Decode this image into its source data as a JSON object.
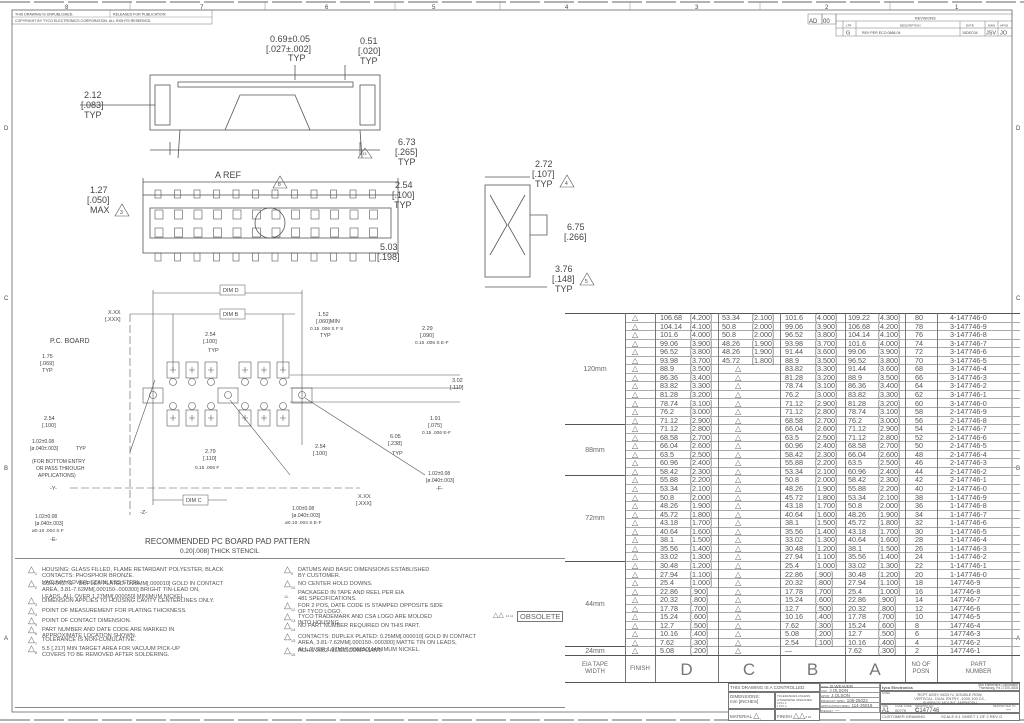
{
  "sheet": {
    "zones_top": [
      "8",
      "7",
      "6",
      "5",
      "4",
      "3",
      "2",
      "1"
    ],
    "zones_side": [
      "D",
      "C",
      "B",
      "A"
    ],
    "unpublished": "THIS DRAWING IS UNPUBLISHED.",
    "released": "RELEASED FOR PUBLICATION",
    "copyright": "COPYRIGHT   BY TYCO ELECTRONICS CORPORATION. ALL RIGHTS RESERVED."
  },
  "revisions": {
    "title": "REVISIONS",
    "dist": "AD",
    "sheet_code": "00",
    "col_ltr": "LTR",
    "col_description": "DESCRIPTION",
    "col_date": "DATE",
    "col_dwn": "DWN",
    "col_apvd": "APVD",
    "ltr": "G",
    "description": "REV PER ECO 0686 04",
    "date": "15DEC04",
    "dwn": "JSV",
    "apvd": "JO"
  },
  "views": {
    "front": {
      "d1": "0.69±0.05",
      "d1b": "[.027±.002]",
      "d1c": "TYP",
      "d2": "0.51",
      "d2b": "[.020]",
      "d2c": "TYP",
      "d3": "2.12",
      "d3b": "[.083]",
      "d3c": "TYP",
      "d4": "6.73",
      "d4b": "[.265]",
      "d4c": "TYP",
      "flag": "13"
    },
    "top": {
      "aref": "A REF",
      "flag8": "8",
      "d1": "1.27",
      "d1b": "[.050]",
      "d1c": "MAX",
      "flag3": "3",
      "d2": "2.54",
      "d2b": "[.100]",
      "d2c": "TYP",
      "flag7": "7",
      "d3": "5.03",
      "d3b": "[.198]"
    },
    "side": {
      "d1": "2.72",
      "d1b": "[.107]",
      "d1c": "TYP",
      "flag4": "4",
      "d2": "6.75",
      "d2b": "[.266]",
      "d3": "3.76",
      "d3b": "[.148]",
      "d3c": "TYP",
      "flag5": "5"
    },
    "pad": {
      "dim_d": "DIM D",
      "dim_b": "DIM B",
      "dim_c": "DIM C",
      "xx": "X.XX",
      "xxx": "[.XXX]",
      "flag9": "9",
      "pcb": "P.C. BOARD",
      "a1": "1.75",
      "a1b": "[.069]",
      "a1c": "TYP",
      "a2": "2.54",
      "a2b": "[.100]",
      "a2c": "TYP",
      "a3": "1.52",
      "a3b": "[.060]MIN",
      "a3c": "0.15  .006 S F S",
      "a3d": "TYP",
      "a4": "2.29",
      "a4b": "[.090]",
      "a4c": "0.15  .006 S E-F",
      "a5": "3.02",
      "a5b": "[.119]",
      "a6": "2.54",
      "a6b": "[.100]",
      "a7": "1.91",
      "a7b": "[.075]",
      "a7c": "0.15  .006 E-F",
      "a8": "6.05",
      "a8b": "[.238]",
      "a8c": "TYP",
      "a9": "2.54",
      "a9b": "[.100]",
      "a10": "2.79",
      "a10b": "[.110]",
      "a10c": "0.15  .006 F",
      "h1": "1.02±0.08",
      "h1b": "[ø.040±.003]",
      "h1c": "TYP",
      "bottom_entry": "(FOR BOTTOM ENTRY",
      "bottom_entry2": "OR PASS THROUGH",
      "bottom_entry3": "APPLICATIONS)",
      "h2": "1.02±0.08",
      "h2b": "[ø.040±.003]",
      "h2c": "ø0.10  .004 S F",
      "h3": "1.00±0.08",
      "h3b": "[ø.040±.003]",
      "h3c": "ø0.10  .004 S E-F",
      "h4": "1.02±0.08",
      "h4b": "[ø.040±.003]",
      "datum_y": "-Y-",
      "datum_z": "-Z-",
      "datum_e": "-E-",
      "datum_f": "-F-",
      "caption": "RECOMMENDED PC BOARD PAD PATTERN",
      "caption2": "0.20[.008] THICK STENCIL"
    }
  },
  "notes": [
    {
      "num": "1",
      "text": "HOUSING: GLASS FILLED, FLAME RETARDANT POLYESTER, BLACK\nCONTACTS: PHOSPHOR BRONZE.\nVACUUM COVER: STAINLESS STEEL"
    },
    {
      "num": "2",
      "text": "CONTACTS:   DUPLEX PLATED: 0.25µm[.000010] GOLD IN CONTACT\nAREA, 3.81-7.62µm[.000150-.000300] BRIGHT TIN-LEAD ON,\nLEADS, ALL OVER 1.27µm[.000050] MINIMUM NICKEL."
    },
    {
      "num": "3",
      "text": "DIMENSION APPLIES TO HOUSING CAVITY CENTERLINES ONLY."
    },
    {
      "num": "4",
      "text": "POINT OF MEASUREMENT FOR PLATING THICKNESS."
    },
    {
      "num": "5",
      "text": "POINT OF CONTACT DIMENSION."
    },
    {
      "num": "6",
      "text": "PART NUMBER AND DATE CODE ARE MARKED IN\nAPPROXIMATE LOCATION SHOWN."
    },
    {
      "num": "7",
      "text": "TOLERANCE IS NON-CUMULATIVE."
    },
    {
      "num": "8",
      "text": "5.5 [.217] MIN TARGET AREA FOR VACUUM PICK-UP\nCOVERS TO BE REMOVED AFTER SOLDERING."
    },
    {
      "num": "9",
      "text": "DATUMS AND BASIC DIMENSIONS ESTABLISHED\nBY CUSTOMER."
    },
    {
      "num": "10",
      "text": "NO CENTER HOLD DOWNS."
    },
    {
      "num": "11.",
      "text": "PACKAGED IN TAPE AND REEL PER EIA\n481 SPECIFICATIONS."
    },
    {
      "num": "12",
      "text": "FOR 2 POS, DATE CODE IS STAMPED OPPOSITE SIDE\nOF TYCO LOGO."
    },
    {
      "num": "13",
      "text": "TYCO TRADEMARK AND CSA LOGO ARE MOLDED\nINTO HOUSING."
    },
    {
      "num": "14",
      "text": "NO PART NUMBER REQUIRED ON THIS PART."
    },
    {
      "num": "15",
      "text": "CONTACTS: DUPLEX PLATED: 0.25µm[.000010] GOLD IN CONTACT\nAREA, 3.81-7.62µm[.000150-.000300] MATTE TIN ON LEADS,\nALL OVER 1.27µm[.000050] MINIMUM NICKEL."
    },
    {
      "num": "16",
      "text": "ROHS 2002 /95/EC COMPLIANT."
    }
  ],
  "table": {
    "obsolete_flags": "12 14",
    "obsolete": "OBSOLETE",
    "finish_flag": "13",
    "headers": {
      "tape": "EIA TAPE\nWIDTH",
      "finish": "FINISH",
      "d": "D",
      "c": "C",
      "b": "B",
      "a": "A",
      "posn": "NO OF\nPOSN",
      "part": "PART\nNUMBER"
    },
    "groups": [
      {
        "label": "120mm",
        "rows": 13
      },
      {
        "label": "88mm",
        "rows": 6
      },
      {
        "label": "72mm",
        "rows": 10
      },
      {
        "label": "44mm",
        "rows": 10
      },
      {
        "label": "24mm",
        "rows": 1
      }
    ],
    "rows": [
      [
        "106.68",
        "[4.200]",
        "53.34",
        "[2.100]",
        "101.6",
        "[4.000]",
        "109.22",
        "[4.300]",
        "80",
        "4-147746-0"
      ],
      [
        "104.14",
        "[4.100]",
        "50.8",
        "[2.000]",
        "99.06",
        "[3.900]",
        "106.68",
        "[4.200]",
        "78",
        "3-147746-9"
      ],
      [
        "101.6",
        "[4.000]",
        "50.8",
        "[2.000]",
        "96.52",
        "[3.800]",
        "104.14",
        "[4.100]",
        "76",
        "3-147746-8"
      ],
      [
        "99.06",
        "[3.900]",
        "48.26",
        "[1.900]",
        "93.98",
        "[3.700]",
        "101.6",
        "[4.000]",
        "74",
        "3-147746-7"
      ],
      [
        "96.52",
        "[3.800]",
        "48.26",
        "[1.900]",
        "91.44",
        "[3.600]",
        "99.06",
        "[3.900]",
        "72",
        "3-147746-6"
      ],
      [
        "93.98",
        "[3.700]",
        "45.72",
        "[1.800]",
        "88.9",
        "[3.500]",
        "96.52",
        "[3.800]",
        "70",
        "3-147746-5"
      ],
      [
        "88.9",
        "[3.500]",
        "",
        "",
        "83.82",
        "[3.300]",
        "91.44",
        "[3.600]",
        "68",
        "3-147746-4"
      ],
      [
        "86.36",
        "[3.400]",
        "",
        "",
        "81.28",
        "[3.200]",
        "88.9",
        "[3.500]",
        "66",
        "3-147746-3"
      ],
      [
        "83.82",
        "[3.300]",
        "",
        "",
        "78.74",
        "[3.100]",
        "86.36",
        "[3.400]",
        "64",
        "3-147746-2"
      ],
      [
        "81.28",
        "[3.200]",
        "",
        "",
        "76.2",
        "[3.000]",
        "83.82",
        "[3.300]",
        "62",
        "3-147746-1"
      ],
      [
        "78.74",
        "[3.100]",
        "",
        "",
        "71.12",
        "[2.900]",
        "81.28",
        "[3.200]",
        "60",
        "3-147746-0"
      ],
      [
        "76.2",
        "[3.000]",
        "",
        "",
        "71.12",
        "[2.800]",
        "78.74",
        "[3.100]",
        "58",
        "2-147746-9"
      ],
      [
        "71.12",
        "[2.900]",
        "",
        "",
        "68.58",
        "[2.700]",
        "76.2",
        "[3.000]",
        "56",
        "2-147746-8"
      ],
      [
        "71.12",
        "[2.800]",
        "",
        "",
        "66.04",
        "[2.600]",
        "71.12",
        "[2.900]",
        "54",
        "2-147746-7"
      ],
      [
        "68.58",
        "[2.700]",
        "",
        "",
        "63.5",
        "[2.500]",
        "71.12",
        "[2.800]",
        "52",
        "2-147746-6"
      ],
      [
        "66.04",
        "[2.600]",
        "",
        "",
        "60.96",
        "[2.400]",
        "68.58",
        "[2.700]",
        "50",
        "2-147746-5"
      ],
      [
        "63.5",
        "[2.500]",
        "",
        "",
        "58.42",
        "[2.300]",
        "66.04",
        "[2.600]",
        "48",
        "2-147746-4"
      ],
      [
        "60.96",
        "[2.400]",
        "",
        "",
        "55.88",
        "[2.200]",
        "63.5",
        "[2.500]",
        "46",
        "2-147746-3"
      ],
      [
        "58.42",
        "[2.300]",
        "",
        "",
        "53.34",
        "[2.100]",
        "60.96",
        "[2.400]",
        "44",
        "2-147746-2"
      ],
      [
        "55.88",
        "[2.200]",
        "",
        "",
        "50.8",
        "[2.000]",
        "58.42",
        "[2.300]",
        "42",
        "2-147746-1"
      ],
      [
        "53.34",
        "[2.100]",
        "",
        "",
        "48.26",
        "[1.900]",
        "55.88",
        "[2.200]",
        "40",
        "2-147746-0"
      ],
      [
        "50.8",
        "[2.000]",
        "",
        "",
        "45.72",
        "[1.800]",
        "53.34",
        "[2.100]",
        "38",
        "1-147746-9"
      ],
      [
        "48.26",
        "[1.900]",
        "",
        "",
        "43.18",
        "[1.700]",
        "50.8",
        "[2.000]",
        "36",
        "1-147746-8"
      ],
      [
        "45.72",
        "[1.800]",
        "",
        "",
        "40.64",
        "[1.600]",
        "48.26",
        "[1.900]",
        "34",
        "1-147746-7"
      ],
      [
        "43.18",
        "[1.700]",
        "",
        "",
        "38.1",
        "[1.500]",
        "45.72",
        "[1.800]",
        "32",
        "1-147746-6"
      ],
      [
        "40.64",
        "[1.600]",
        "",
        "",
        "35.56",
        "[1.400]",
        "43.18",
        "[1.700]",
        "30",
        "1-147746-5"
      ],
      [
        "38.1",
        "[1.500]",
        "",
        "",
        "33.02",
        "[1.300]",
        "40.64",
        "[1.600]",
        "28",
        "1-147746-4"
      ],
      [
        "35.56",
        "[1.400]",
        "",
        "",
        "30.48",
        "[1.200]",
        "38.1",
        "[1.500]",
        "26",
        "1-147746-3"
      ],
      [
        "33.02",
        "[1.300]",
        "",
        "",
        "27.94",
        "[1.100]",
        "35.56",
        "[1.400]",
        "24",
        "1-147746-2"
      ],
      [
        "30.48",
        "[1.200]",
        "",
        "",
        "25.4",
        "[1.000]",
        "33.02",
        "[1.300]",
        "22",
        "1-147746-1"
      ],
      [
        "27.94",
        "[1.100]",
        "",
        "",
        "22.86",
        "[.900]",
        "30.48",
        "[1.200]",
        "20",
        "1-147746-0"
      ],
      [
        "25.4",
        "[1.000]",
        "",
        "",
        "20.32",
        "[.800]",
        "27.94",
        "[1.100]",
        "18",
        "147746-9"
      ],
      [
        "22.86",
        "[.900]",
        "",
        "",
        "17.78",
        "[.700]",
        "25.4",
        "[1.000]",
        "16",
        "147746-8"
      ],
      [
        "20.32",
        "[.800]",
        "",
        "",
        "15.24",
        "[.600]",
        "22.86",
        "[.900]",
        "14",
        "147746-7"
      ],
      [
        "17.78",
        "[.700]",
        "",
        "",
        "12.7",
        "[.500]",
        "20.32",
        "[.800]",
        "12",
        "147746-6"
      ],
      [
        "15.24",
        "[.600]",
        "",
        "",
        "10.16",
        "[.400]",
        "17.78",
        "[.700]",
        "10",
        "147746-5"
      ],
      [
        "12.7",
        "[.500]",
        "",
        "",
        "7.62",
        "[.300]",
        "15.24",
        "[.600]",
        "8",
        "147746-4"
      ],
      [
        "10.16",
        "[.400]",
        "",
        "",
        "5.08",
        "[.200]",
        "12.7",
        "[.500]",
        "6",
        "147746-3"
      ],
      [
        "7.62",
        "[.300]",
        "",
        "",
        "2.54",
        "[.100]",
        "10.16",
        "[.400]",
        "4",
        "147746-2"
      ],
      [
        "5.08",
        "[.200]",
        "",
        "",
        "—",
        "",
        "7.62",
        "[.300]",
        "2",
        "147746-1"
      ]
    ]
  },
  "title_block": {
    "controlled": "THIS DRAWING IS A CONTROLLED DOCUMENT.",
    "dimensions": "DIMENSIONS:",
    "dim_units": "mm [INCHES]",
    "tolerances": "TOLERANCES UNLESS OTHERWISE SPECIFIED:",
    "tol_lines": "0 PLC ±-\n1 PLC ±-\n2 PLC ± 0.13[.005]\n3 PLC ± 0.05[.002]\n4 PLC ±-\nANGLES ±-",
    "material": "MATERIAL",
    "material_flag": "1",
    "finish": "FINISH",
    "finish_flags": "2 15",
    "dwn_label": "DWN",
    "dwn": "B.WEAVER",
    "chk_label": "CHK",
    "chk": "J.OLSON",
    "appvd_label": "APVD",
    "appvd": "J.OLSON",
    "product_spec_label": "PRODUCT SPEC",
    "product_spec": "108-25022",
    "app_spec_label": "APPLICATION SPEC",
    "app_spec": "114-25018",
    "weight_label": "WEIGHT",
    "weight": "—",
    "brand": "tyco Electronics",
    "company": "Tyco Electronics Corporation",
    "address": "Harrisburg, Pa 17105-3608",
    "name_label": "NAME",
    "name": "RCPT ASSY, MOD IV, DOUBLE ROW,\nVERTICAL, DUAL ENTRY, .100X.100 C/L,\nSURFACE MOUNT, AMPMODU",
    "size_label": "SIZE",
    "size": "A1",
    "cage_label": "CAGE CODE",
    "cage": "00779",
    "dwg_label": "DRAWING NO",
    "dwg_prefix": "C",
    "dwg": "147746",
    "restricted_label": "RESTRICTED TO",
    "restricted": "—",
    "customer_drawing": "CUSTOMER DRAWING",
    "scale_label": "SCALE",
    "scale": "6:1",
    "sheet_label": "SHEET",
    "sheet": "1",
    "of_label": "OF",
    "of": "2",
    "rev_label": "REV",
    "rev": "G"
  }
}
